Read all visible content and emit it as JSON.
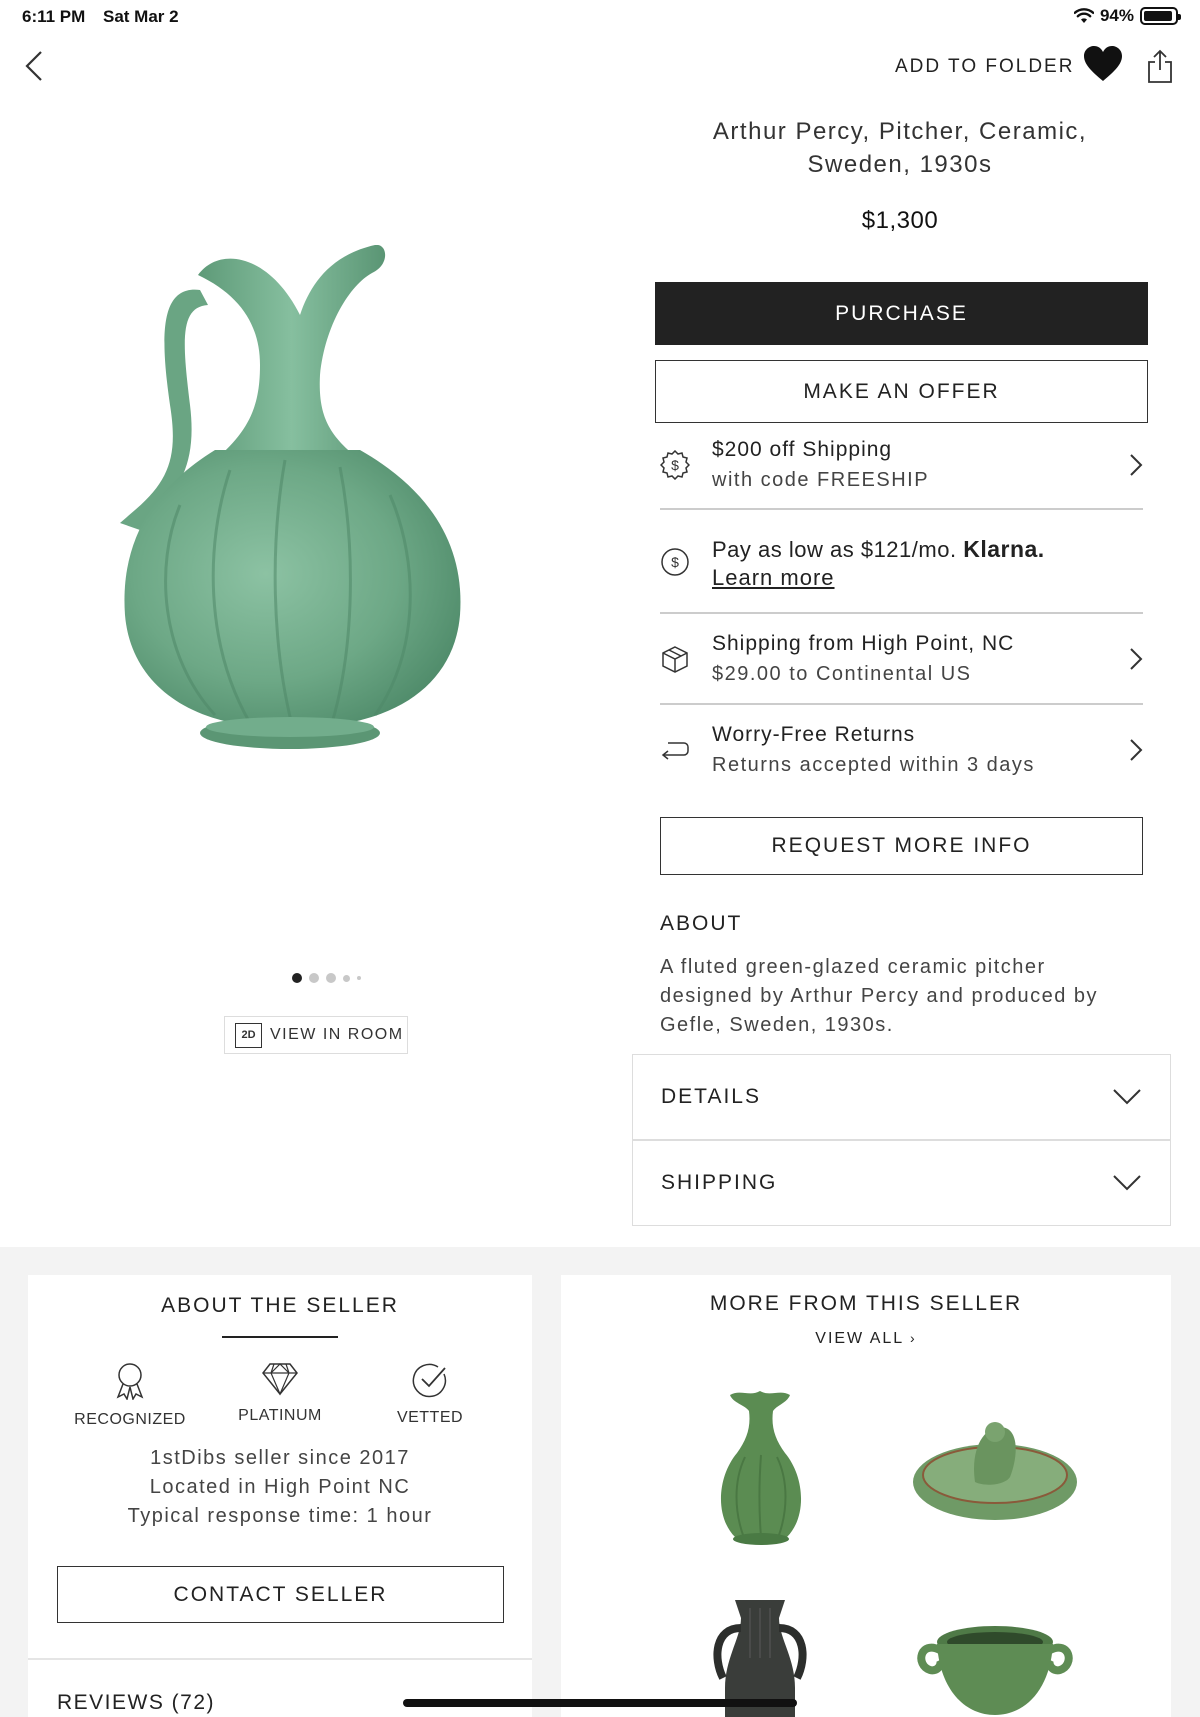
{
  "status_bar": {
    "time": "6:11 PM",
    "date": "Sat Mar 2",
    "battery": "94%",
    "battery_level": 0.94
  },
  "header": {
    "add_to_folder": "ADD TO FOLDER"
  },
  "product": {
    "title_line1": "Arthur Percy, Pitcher, Ceramic,",
    "title_line2": "Sweden, 1930s",
    "price": "$1,300",
    "image_count": 5,
    "active_image": 0,
    "view_in_room_badge": "2D",
    "view_in_room": "VIEW IN ROOM",
    "glaze_color": "#6fa888"
  },
  "actions": {
    "purchase": "PURCHASE",
    "make_offer": "MAKE AN OFFER",
    "request_info": "REQUEST MORE INFO"
  },
  "promo": {
    "line1": "$200 off Shipping",
    "line2": "with code FREESHIP"
  },
  "klarna": {
    "prefix": "Pay as low as $121/mo.",
    "brand": "Klarna.",
    "link": "Learn more"
  },
  "shipping": {
    "line1": "Shipping from High Point, NC",
    "line2": "$29.00 to Continental US"
  },
  "returns": {
    "line1": "Worry-Free Returns",
    "line2": "Returns accepted within 3 days"
  },
  "about": {
    "heading": "ABOUT",
    "text": "A fluted green-glazed ceramic pitcher designed by Arthur Percy and produced by Gefle, Sweden, 1930s."
  },
  "accordions": {
    "details": "DETAILS",
    "shipping": "SHIPPING"
  },
  "seller": {
    "heading": "ABOUT THE SELLER",
    "badges": [
      "RECOGNIZED",
      "PLATINUM",
      "VETTED"
    ],
    "since": "1stDibs seller since 2017",
    "location": "Located in High Point NC",
    "response": "Typical response time: 1 hour",
    "contact": "CONTACT SELLER",
    "reviews": "REVIEWS (72)"
  },
  "more_from_seller": {
    "heading": "MORE FROM THIS SELLER",
    "view_all": "VIEW ALL"
  }
}
